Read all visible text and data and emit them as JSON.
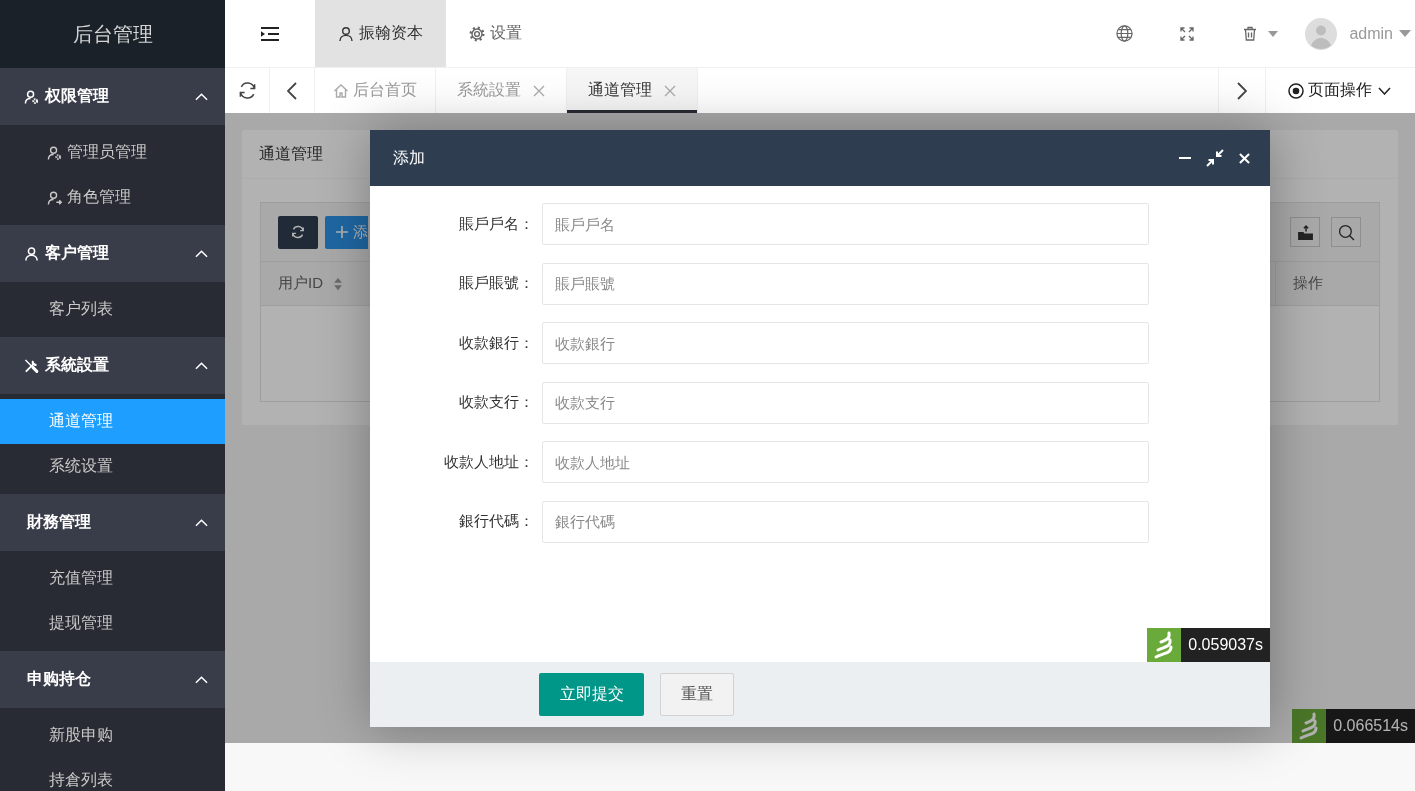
{
  "sidebar": {
    "title": "后台管理",
    "groups": [
      {
        "label": "权限管理",
        "kind": "admin",
        "expanded": true,
        "items": [
          {
            "label": "管理员管理",
            "kind": "admin",
            "selected": false
          },
          {
            "label": "角色管理",
            "kind": "role",
            "selected": false
          }
        ]
      },
      {
        "label": "客户管理",
        "kind": "user",
        "expanded": true,
        "items": [
          {
            "label": "客户列表",
            "kind": "text",
            "selected": false
          }
        ]
      },
      {
        "label": "系統設置",
        "kind": "tools",
        "expanded": true,
        "items": [
          {
            "label": "通道管理",
            "kind": "text",
            "selected": true
          },
          {
            "label": "系统设置",
            "kind": "text",
            "selected": false
          }
        ]
      },
      {
        "label": "財務管理",
        "kind": "text",
        "expanded": true,
        "items": [
          {
            "label": "充值管理",
            "kind": "text",
            "selected": false
          },
          {
            "label": "提现管理",
            "kind": "text",
            "selected": false
          }
        ]
      },
      {
        "label": "申购持仓",
        "kind": "text",
        "expanded": true,
        "items": [
          {
            "label": "新股申购",
            "kind": "text",
            "selected": false
          },
          {
            "label": "持倉列表",
            "kind": "text",
            "selected": false
          }
        ]
      }
    ]
  },
  "header": {
    "nav": [
      {
        "label": "振翰资本",
        "kind": "user",
        "selected": true
      },
      {
        "label": "设置",
        "kind": "gear",
        "selected": false
      }
    ],
    "user": "admin"
  },
  "page_tabs": [
    {
      "label": "后台首页",
      "kind": "home",
      "selected": false
    },
    {
      "label": "系統設置",
      "kind": "page",
      "selected": false
    },
    {
      "label": "通道管理",
      "kind": "page",
      "selected": true
    }
  ],
  "page_actions": "页面操作",
  "panel": {
    "title": "通道管理",
    "add_button": "添",
    "columns": [
      {
        "label": "用户ID",
        "sortable": true
      },
      {
        "label": "操作",
        "sortable": false
      }
    ],
    "timer": "0.066514s"
  },
  "dialog": {
    "title": "添加",
    "fields": [
      {
        "label": "賬戶戶名：",
        "placeholder": "賬戶戶名"
      },
      {
        "label": "賬戶賬號：",
        "placeholder": "賬戶賬號"
      },
      {
        "label": "收款銀行：",
        "placeholder": "收款銀行"
      },
      {
        "label": "收款支行：",
        "placeholder": "收款支行"
      },
      {
        "label": "收款人地址：",
        "placeholder": "收款人地址"
      },
      {
        "label": "銀行代碼：",
        "placeholder": "銀行代碼"
      }
    ],
    "buttons": [
      {
        "label": "立即提交",
        "kind": "primary"
      },
      {
        "label": "重置",
        "kind": "plain"
      }
    ],
    "timer": "0.059037s"
  }
}
